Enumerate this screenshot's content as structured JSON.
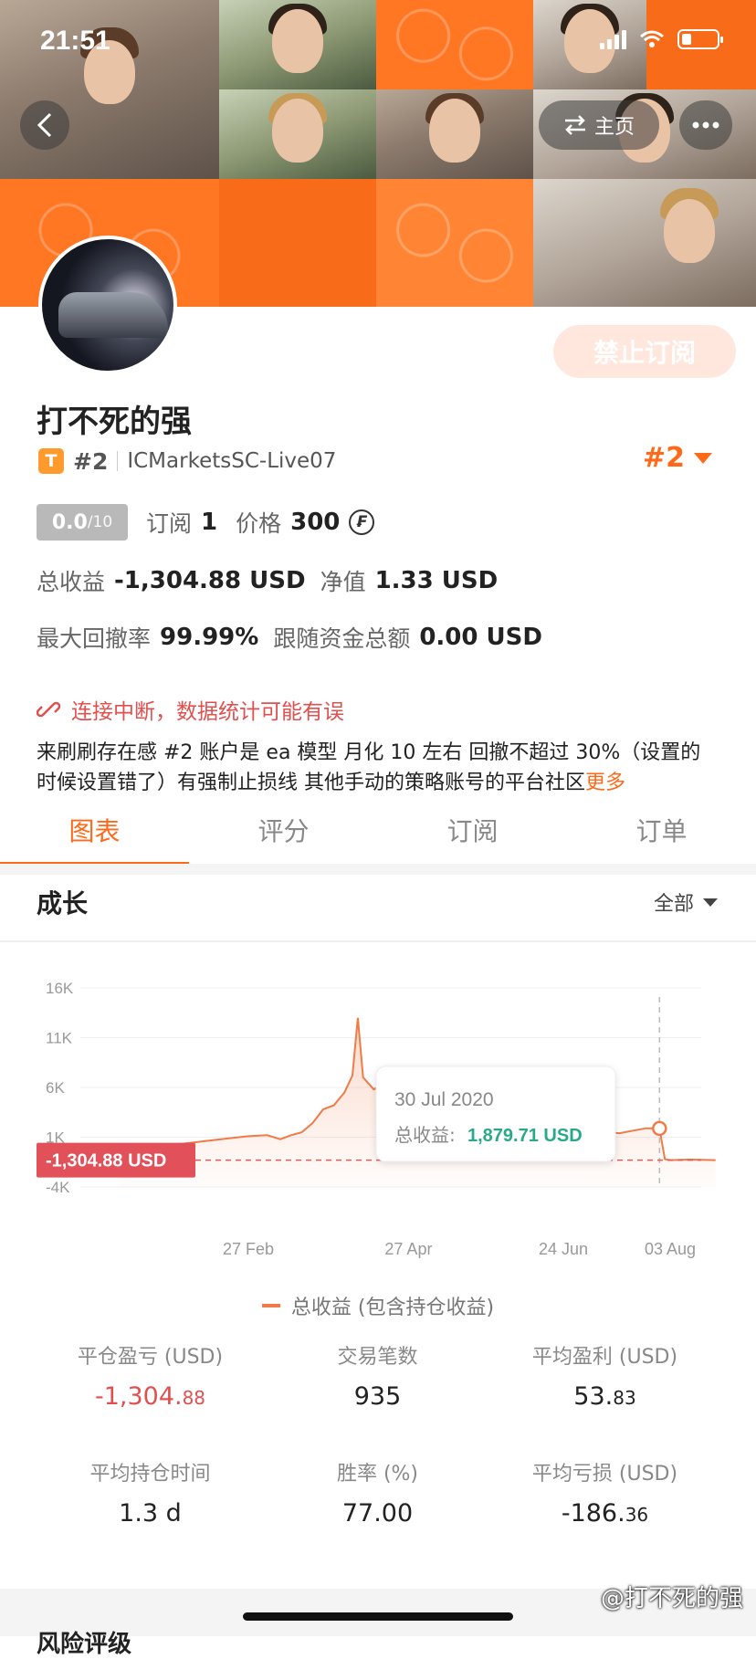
{
  "status_bar": {
    "time": "21:51"
  },
  "header": {
    "home_label": "主页",
    "back_icon": "chevron-left-icon",
    "more_icon": "more-dots-icon",
    "swap_icon": "swap-arrows-icon"
  },
  "profile": {
    "subscribe_button": "禁止订阅",
    "name": "打不死的强",
    "badge_letter": "T",
    "rank_small": "#2",
    "account_name": "ICMarketsSC-Live07",
    "rank_big": "#2",
    "score": "0.0",
    "score_max": "/10",
    "subscribe_label": "订阅",
    "subscribe_count": "1",
    "price_label": "价格",
    "price": "300",
    "price_currency_symbol": "₣",
    "total_profit_label": "总收益",
    "total_profit": "-1,304.88 USD",
    "equity_label": "净值",
    "equity": "1.33 USD",
    "max_drawdown_label": "最大回撤率",
    "max_drawdown": "99.99%",
    "follow_funds_label": "跟随资金总额",
    "follow_funds": "0.00 USD",
    "warning": "连接中断，数据统计可能有误",
    "description": "来刷刷存在感 #2 账户是 ea 模型  月化 10 左右 回撤不超过 30%（设置的时候设置错了）有强制止损线 其他手动的策略账号的平台社区",
    "more_link": "更多"
  },
  "tabs": [
    "图表",
    "评分",
    "订阅",
    "订单"
  ],
  "growth": {
    "title": "成长",
    "range": "全部"
  },
  "chart_data": {
    "type": "line",
    "title": "",
    "x_ticks": [
      "27 Feb",
      "27 Apr",
      "24 Jun",
      "03 Aug"
    ],
    "y_ticks": [
      "16K",
      "11K",
      "6K",
      "1K",
      "-4K"
    ],
    "ylim": [
      -4000,
      16000
    ],
    "series": [
      {
        "name": "总收益 (包含持仓收益)",
        "color": "#f07b47",
        "x": [
          "2020-01-10",
          "2020-02-01",
          "2020-02-20",
          "2020-02-27",
          "2020-03-05",
          "2020-03-10",
          "2020-03-14",
          "2020-03-18",
          "2020-03-22",
          "2020-03-26",
          "2020-03-30",
          "2020-04-03",
          "2020-04-06",
          "2020-04-08",
          "2020-04-10",
          "2020-04-14",
          "2020-04-20",
          "2020-04-27",
          "2020-05-05",
          "2020-05-15",
          "2020-05-25",
          "2020-06-05",
          "2020-06-15",
          "2020-06-24",
          "2020-07-05",
          "2020-07-15",
          "2020-07-25",
          "2020-07-30",
          "2020-08-01",
          "2020-08-03",
          "2020-08-10",
          "2020-08-20"
        ],
        "values": [
          0,
          300,
          900,
          1100,
          1200,
          800,
          1200,
          1500,
          2400,
          3800,
          4200,
          5500,
          7200,
          13000,
          7000,
          5800,
          6800,
          6500,
          4800,
          3500,
          2600,
          2200,
          1300,
          2200,
          1600,
          1400,
          1900,
          1879.71,
          -1200,
          -1300,
          -1250,
          -1304.88
        ]
      }
    ],
    "tooltip": {
      "date": "30 Jul 2020",
      "label": "总收益:",
      "value": "1,879.71 USD"
    },
    "current_value_label": "-1,304.88 USD",
    "current_value": -1304.88,
    "grid": true,
    "legend": "bottom-center"
  },
  "metrics": [
    {
      "label": "平仓盈亏 (USD)",
      "value_main": "-1,304.",
      "value_small": "88",
      "negative": true
    },
    {
      "label": "交易笔数",
      "value_main": "935",
      "value_small": "",
      "negative": false
    },
    {
      "label": "平均盈利 (USD)",
      "value_main": "53.",
      "value_small": "83",
      "negative": false
    },
    {
      "label": "平均持仓时间",
      "value_main": "1.3 d",
      "value_small": "",
      "negative": false
    },
    {
      "label": "胜率 (%)",
      "value_main": "77.00",
      "value_small": "",
      "negative": false
    },
    {
      "label": "平均亏损 (USD)",
      "value_main": "-186.",
      "value_small": "36",
      "negative": false
    }
  ],
  "next_section_title": "风险评级",
  "watermark": "@打不死的强"
}
